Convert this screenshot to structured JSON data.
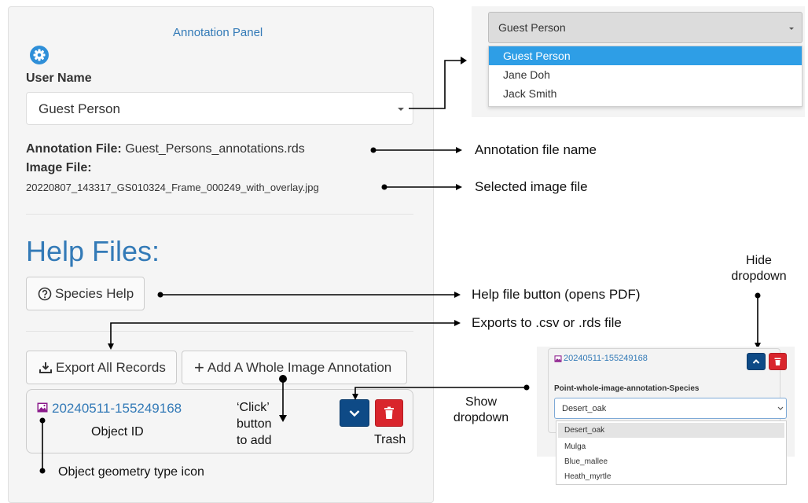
{
  "panel": {
    "title": "Annotation Panel",
    "user_name_label": "User Name",
    "user_select_value": "Guest Person",
    "annotation_file_label": "Annotation File:",
    "annotation_file_value": "Guest_Persons_annotations.rds",
    "image_file_label": "Image File:",
    "image_file_value": "20220807_143317_GS010324_Frame_000249_with_overlay.jpg",
    "help_heading": "Help Files:",
    "species_help_button": "Species Help",
    "export_button": "Export All Records",
    "add_whole_image_button": "Add A Whole Image Annotation",
    "object_id": "20240511-155249168"
  },
  "user_dropdown": {
    "selected": "Guest Person",
    "options": [
      "Guest Person",
      "Jane Doh",
      "Jack Smith"
    ]
  },
  "species_dropdown": {
    "object_id": "20240511-155249168",
    "field_label": "Point-whole-image-annotation-Species",
    "selected": "Desert_oak",
    "options": [
      "Desert_oak",
      "Mulga",
      "Blue_mallee",
      "Heath_myrtle"
    ]
  },
  "annotations": {
    "annotation_file_name": "Annotation file name",
    "selected_image_file": "Selected image file",
    "help_file_button": "Help file button (opens PDF)",
    "exports_to": "Exports to .csv or .rds file",
    "hide_dropdown_line1": "Hide",
    "hide_dropdown_line2": "dropdown",
    "show_dropdown_line1": "Show",
    "show_dropdown_line2": "dropdown",
    "click_line1": "‘Click’",
    "click_line2": "button",
    "click_line3": "to add",
    "object_id_label": "Object ID",
    "trash_label": "Trash",
    "geometry_icon_label": "Object geometry type icon"
  },
  "colors": {
    "link_blue": "#337ab7",
    "dark_blue_button": "#0e4a86",
    "red_button": "#d9252c",
    "selected_option": "#2e9ee6",
    "geometry_icon": "#8b1a8b"
  }
}
